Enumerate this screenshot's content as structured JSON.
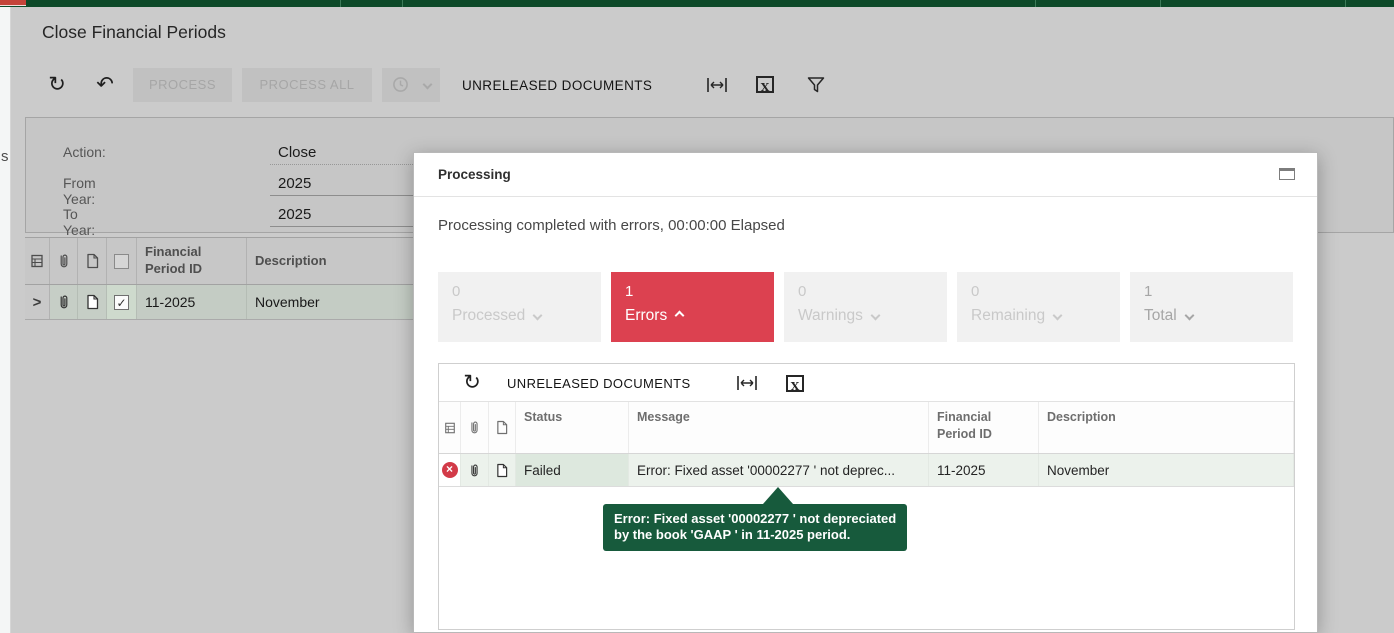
{
  "page": {
    "title": "Close Financial Periods"
  },
  "sidebar": {
    "fragment": "s"
  },
  "toolbar": {
    "process": "PROCESS",
    "process_all": "PROCESS ALL",
    "unreleased_documents": "UNRELEASED DOCUMENTS"
  },
  "filters": {
    "action": {
      "label": "Action:",
      "value": "Close"
    },
    "from_year": {
      "label": "From Year:",
      "value": "2025"
    },
    "to_year": {
      "label": "To Year:",
      "value": "2025"
    }
  },
  "periods_table": {
    "columns": {
      "period": "Financial Period ID",
      "description": "Description"
    },
    "rows": [
      {
        "period": "11-2025",
        "description": "November",
        "selected": true
      }
    ]
  },
  "dialog": {
    "title": "Processing",
    "status_message": "Processing completed with errors, 00:00:00 Elapsed",
    "tiles": [
      {
        "count": "0",
        "label": "Processed",
        "state": "muted",
        "chevron": "down"
      },
      {
        "count": "1",
        "label": "Errors",
        "state": "error",
        "chevron": "up"
      },
      {
        "count": "0",
        "label": "Warnings",
        "state": "muted",
        "chevron": "down"
      },
      {
        "count": "0",
        "label": "Remaining",
        "state": "muted",
        "chevron": "down"
      },
      {
        "count": "1",
        "label": "Total",
        "state": "total",
        "chevron": "down"
      }
    ],
    "toolbar": {
      "unreleased_documents": "UNRELEASED DOCUMENTS"
    },
    "results_table": {
      "columns": {
        "status": "Status",
        "message": "Message",
        "period": "Financial Period ID",
        "description": "Description"
      },
      "rows": [
        {
          "status": "Failed",
          "message": "Error: Fixed asset '00002277 ' not deprec...",
          "period": "11-2025",
          "description": "November"
        }
      ]
    },
    "tooltip": {
      "line1": "Error: Fixed asset '00002277 ' not depreciated",
      "line2": "by the book 'GAAP ' in 11-2025 period."
    }
  },
  "icons": {
    "refresh": "↻",
    "undo": "↶",
    "row_chevron": ">",
    "check": "✓",
    "error_x": "×",
    "excel_x": "X"
  },
  "colors": {
    "top_bar_green": "#0d4a29",
    "error_red": "#dc4150",
    "tooltip_green": "#175a3c",
    "row_selected_green": "#c4ccc4",
    "page_background": "#cbcbcb"
  }
}
